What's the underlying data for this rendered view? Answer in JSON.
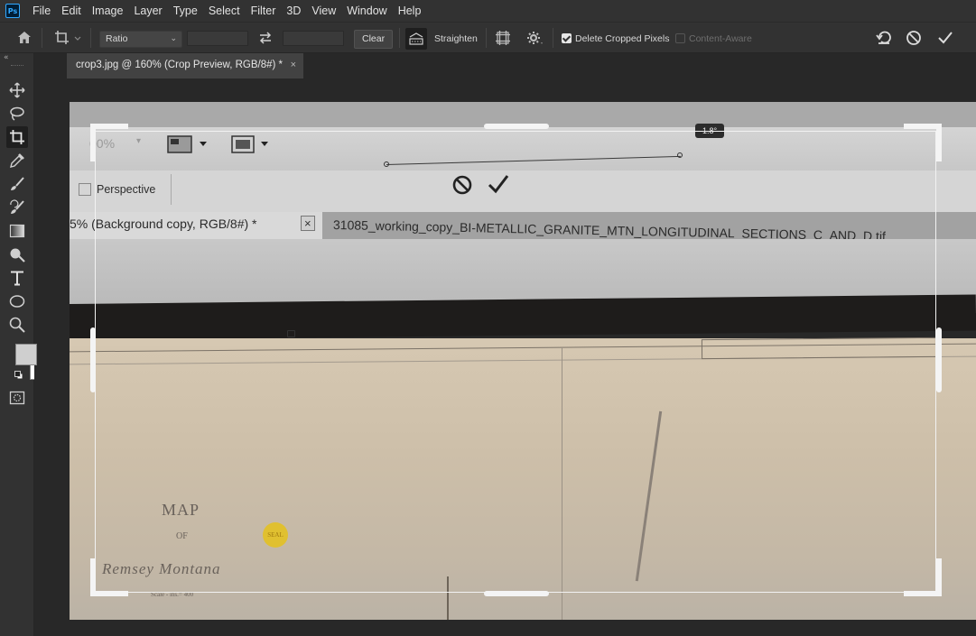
{
  "app": {
    "logo": "Ps"
  },
  "menu": [
    "File",
    "Edit",
    "Image",
    "Layer",
    "Type",
    "Select",
    "Filter",
    "3D",
    "View",
    "Window",
    "Help"
  ],
  "options": {
    "ratio_select": "Ratio",
    "width_value": "",
    "height_value": "",
    "clear_label": "Clear",
    "straighten_label": "Straighten",
    "delete_cropped_label": "Delete Cropped Pixels",
    "delete_cropped_checked": true,
    "content_aware_label": "Content-Aware",
    "content_aware_checked": false
  },
  "document_tab": {
    "title": "crop3.jpg @ 160% (Crop Preview, RGB/8#) *",
    "close": "×"
  },
  "canvas": {
    "rotation_readout": "1.8°",
    "inner_zoom": "00%",
    "inner_perspective": "Perspective",
    "inner_tab_active": "5% (Background copy, RGB/8#) *",
    "inner_tab_close": "×",
    "inner_tab_other": "31085_working_copy_BI-METALLIC_GRANITE_MTN_LONGITUDINAL_SECTIONS_C_AND_D.tif",
    "map_title": "MAP",
    "map_of": "OF",
    "map_place": "Remsey  Montana",
    "map_scale": "Scale - ins.= 400",
    "seal_text": "SEAL"
  },
  "colors": {
    "foreground": "#cfcfcf",
    "background": "#ffffff",
    "ps_blue": "#31a8ff"
  }
}
